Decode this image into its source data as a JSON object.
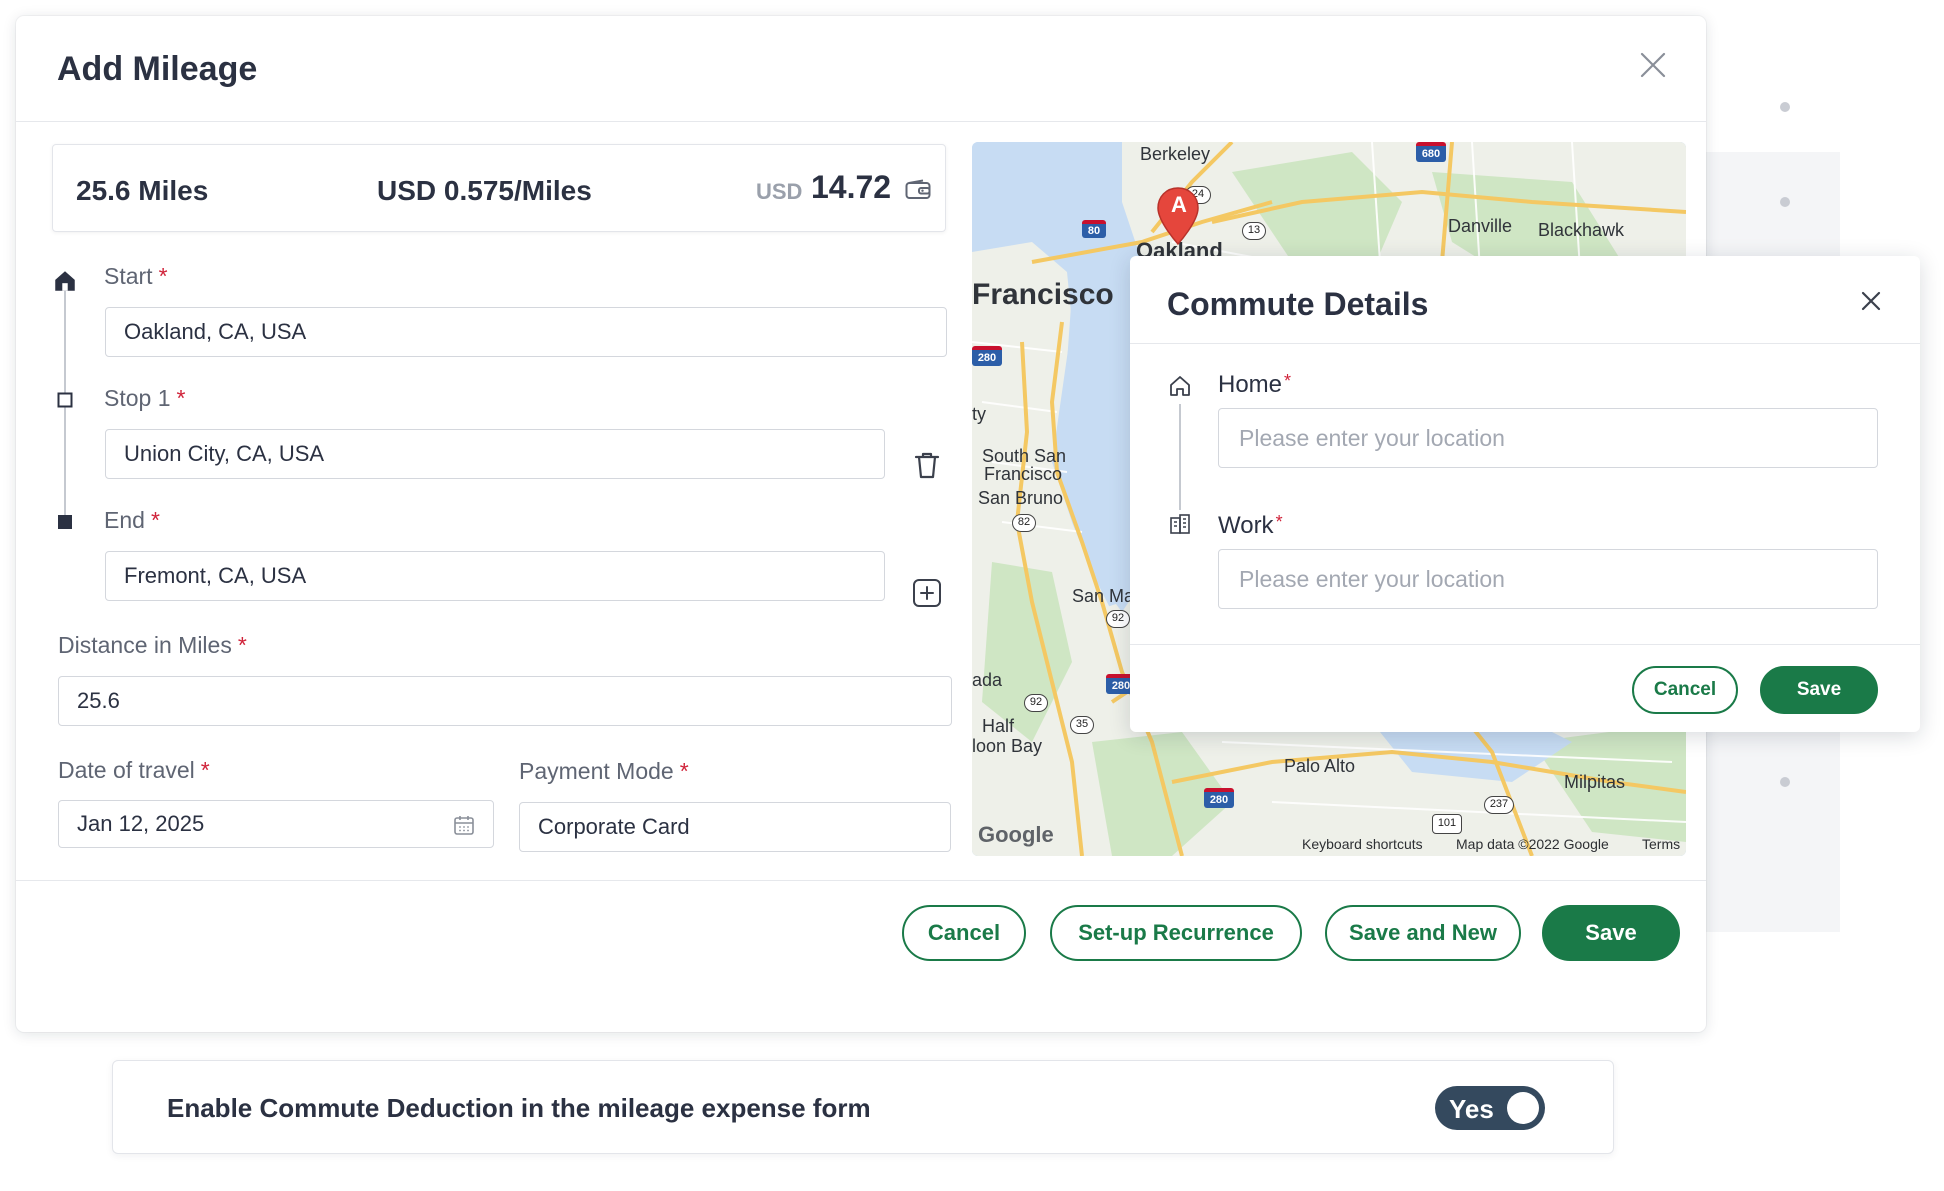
{
  "modal": {
    "title": "Add Mileage",
    "summary": {
      "miles": "25.6 Miles",
      "rate": "USD 0.575/Miles",
      "currency": "USD",
      "amount": "14.72"
    },
    "start": {
      "label": "Start",
      "required_mark": "*",
      "value": "Oakland, CA, USA"
    },
    "stop1": {
      "label": "Stop 1",
      "required_mark": "*",
      "value": "Union City, CA, USA"
    },
    "end": {
      "label": "End",
      "required_mark": "*",
      "value": "Fremont, CA, USA"
    },
    "distance": {
      "label": "Distance in Miles",
      "required_mark": "*",
      "value": "25.6"
    },
    "date": {
      "label": "Date of travel",
      "required_mark": "*",
      "value": "Jan 12, 2025"
    },
    "payment": {
      "label": "Payment Mode",
      "required_mark": "*",
      "value": "Corporate Card"
    },
    "buttons": {
      "cancel": "Cancel",
      "recurrence": "Set-up Recurrence",
      "save_new": "Save and New",
      "save": "Save"
    }
  },
  "map": {
    "marker": "A",
    "places": [
      {
        "text": "Berkeley",
        "size": 18
      },
      {
        "text": "Oakland",
        "size": 22,
        "bold": true
      },
      {
        "text": "Danville",
        "size": 18
      },
      {
        "text": "Blackhawk",
        "size": 18
      },
      {
        "text": "Francisco",
        "size": 30,
        "bold": true
      },
      {
        "text": "ty",
        "size": 18
      },
      {
        "text": "South San",
        "size": 18
      },
      {
        "text": "Francisco",
        "size": 18
      },
      {
        "text": "San Bruno",
        "size": 18
      },
      {
        "text": "San Ma",
        "size": 18
      },
      {
        "text": "ada",
        "size": 18
      },
      {
        "text": "Half",
        "size": 18
      },
      {
        "text": "loon Bay",
        "size": 18
      },
      {
        "text": "Palo Alto",
        "size": 18
      },
      {
        "text": "Milpitas",
        "size": 18
      }
    ],
    "shields": [
      "80",
      "680",
      "24",
      "13",
      "280",
      "82",
      "92",
      "280",
      "92",
      "35",
      "280",
      "101",
      "237"
    ],
    "google_logo": "Google",
    "footer": {
      "shortcuts": "Keyboard shortcuts",
      "data": "Map data ©2022 Google",
      "terms": "Terms"
    },
    "colors": {
      "water": "#c7dcf3",
      "land": "#eef0e9",
      "park": "#cfe6c4",
      "highway": "#f4c863"
    }
  },
  "commute": {
    "title": "Commute Details",
    "home": {
      "label": "Home",
      "required_mark": "*",
      "placeholder": "Please enter your location"
    },
    "work": {
      "label": "Work",
      "required_mark": "*",
      "placeholder": "Please enter your location"
    },
    "buttons": {
      "cancel": "Cancel",
      "save": "Save"
    }
  },
  "toggle_bar": {
    "label": "Enable Commute Deduction in the mileage expense form",
    "toggle_text": "Yes"
  },
  "colors": {
    "primary_green": "#1a7a48",
    "required_red": "#d0233a",
    "toggle_bg": "#34495e",
    "title_text": "#2b3142"
  },
  "icons": [
    "close-icon",
    "wallet-icon",
    "home-icon",
    "square-icon",
    "trash-icon",
    "plus-icon",
    "calendar-icon",
    "map-pin-icon",
    "building-icon"
  ]
}
